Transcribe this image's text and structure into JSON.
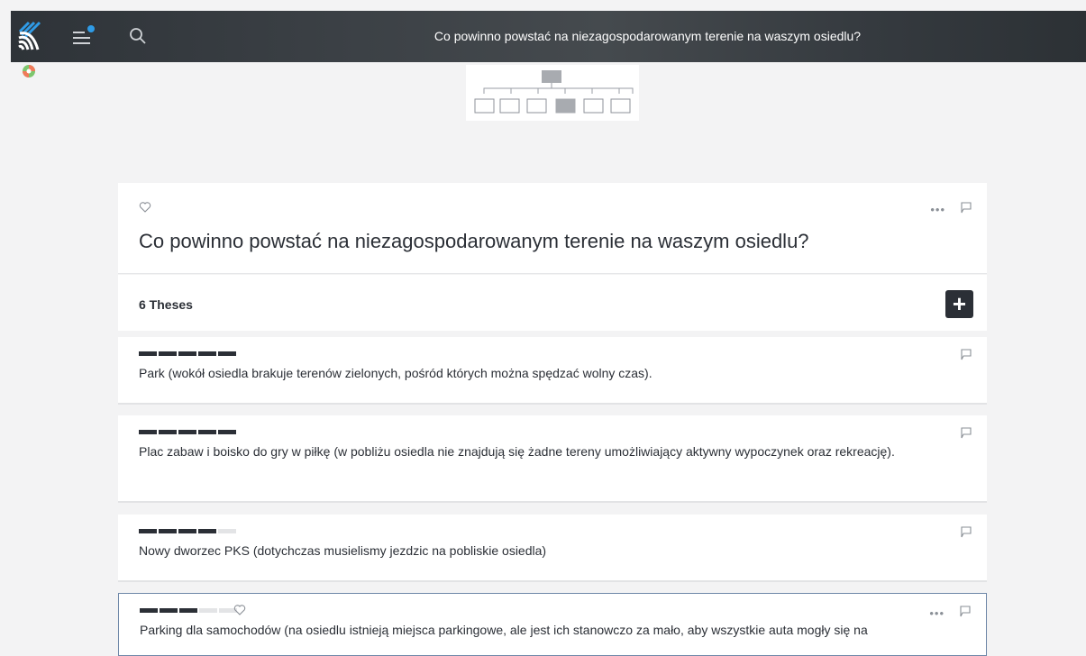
{
  "header": {
    "title": "Co powinno powstać na niezagospodarowanym terenie na waszym osiedlu?",
    "icons": [
      "logo-icon",
      "menu-icon",
      "search-icon"
    ],
    "accent_color": "#2f9be6"
  },
  "question": {
    "title": "Co powinno powstać na niezagospodarowanym terenie na waszym osiedlu?",
    "icons": [
      "heart-icon",
      "more-icon",
      "flag-icon"
    ]
  },
  "theses_header": {
    "count_label": "6 Theses",
    "add_symbol": "+"
  },
  "theses": [
    {
      "text": "Park (wokół osiedla brakuje terenów zielonych, pośród których można spędzać wolny czas).",
      "rating": 5,
      "rating_max": 5
    },
    {
      "text": "Plac zabaw i boisko do gry w piłkę (w pobliżu osiedla nie znajdują się żadne tereny umożliwiający aktywny wypoczynek oraz rekreację).",
      "rating": 5,
      "rating_max": 5
    },
    {
      "text": "Nowy dworzec PKS (dotychczas musielismy jezdzic na pobliskie osiedla)",
      "rating": 4,
      "rating_max": 5
    },
    {
      "text": "Parking dla samochodów (na osiedlu istnieją miejsca parkingowe, ale jest ich stanowczo za mało, aby wszystkie auta mogły się na",
      "rating": 3,
      "rating_max": 5
    }
  ],
  "colors": {
    "dark": "#2b2f36",
    "background": "#f3f3f4",
    "selected_border": "#6e87a8"
  }
}
